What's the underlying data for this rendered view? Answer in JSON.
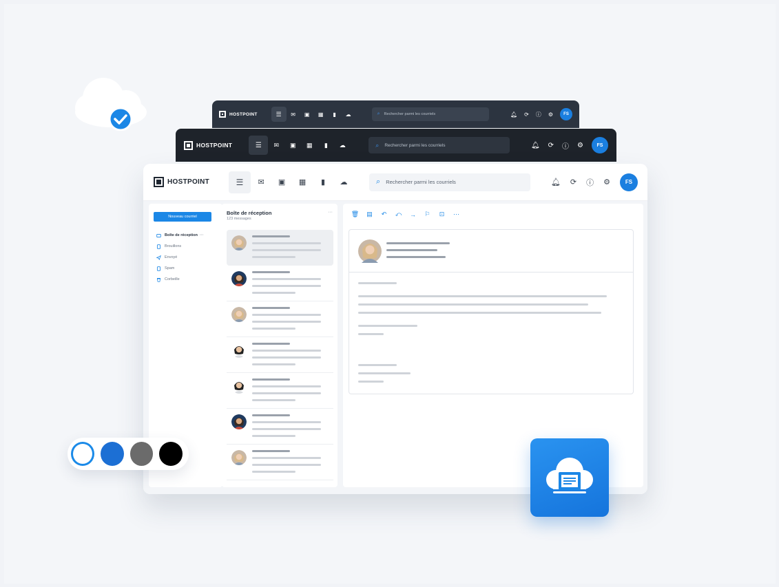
{
  "brand": "HOSTPOINT",
  "search_placeholder": "Rechercher parmi les courriels",
  "user_initials": "FS",
  "compose_label": "Nouveau courriel",
  "folders": [
    {
      "label": "Boîte de réception",
      "icon": "inbox-icon",
      "active": true
    },
    {
      "label": "Brouillons",
      "icon": "draft-icon"
    },
    {
      "label": "Envoyé",
      "icon": "send-icon"
    },
    {
      "label": "Spam",
      "icon": "spam-icon"
    },
    {
      "label": "Corbeille",
      "icon": "trash-icon"
    }
  ],
  "folder_more": "···",
  "inbox": {
    "title": "Boîte de réception",
    "count": "123 messages",
    "more": "···"
  },
  "palette": [
    "#ffffff",
    "#1c6fd4",
    "#6b6b6b",
    "#000000"
  ],
  "accent": "#1b87e6"
}
